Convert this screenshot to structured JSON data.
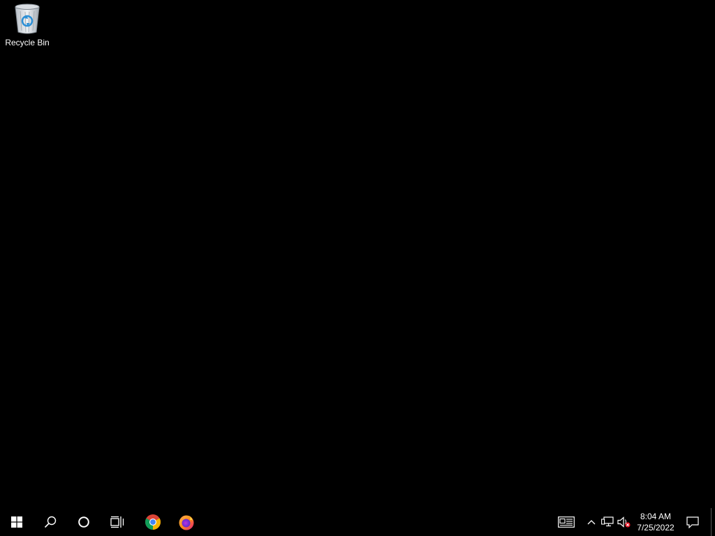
{
  "desktop": {
    "icons": [
      {
        "label": "Recycle Bin",
        "icon": "recycle-bin-icon"
      }
    ]
  },
  "taskbar": {
    "start_icon": "windows-logo-icon",
    "search_icon": "search-icon",
    "cortana_icon": "cortana-circle-icon",
    "task_view_icon": "task-view-icon",
    "pinned_apps": [
      {
        "icon": "chrome-icon"
      },
      {
        "icon": "firefox-icon"
      }
    ],
    "tray": {
      "news_icon": "news-and-interests-icon",
      "chevron_icon": "chevron-up-icon",
      "network_icon": "network-icon",
      "volume_icon": "volume-muted-icon",
      "notification_icon": "action-center-icon"
    },
    "clock": {
      "time": "8:04 AM",
      "date": "7/25/2022"
    }
  },
  "colors": {
    "desktop_background": "#000000",
    "taskbar_background": "#000000",
    "text": "#ffffff",
    "accent": "#0078d7"
  }
}
